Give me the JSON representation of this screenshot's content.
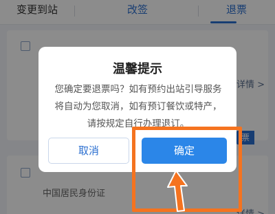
{
  "tabs": [
    {
      "label": "变更到站"
    },
    {
      "label": "改签"
    },
    {
      "label": "退票"
    }
  ],
  "background": {
    "detail_link": "详情 >",
    "button_fragment": "票",
    "id_type": "中国居民身份证"
  },
  "dialog": {
    "title": "温馨提示",
    "message": "您确定要退票吗？如有预约出站引导服务将自动为您取消，如有预订餐饮或特产，请按规定自行办理退订。",
    "cancel_label": "取消",
    "confirm_label": "确定"
  },
  "colors": {
    "accent": "#2b86e8",
    "tab_blue": "#2b6fd0",
    "highlight": "#f5731f"
  }
}
